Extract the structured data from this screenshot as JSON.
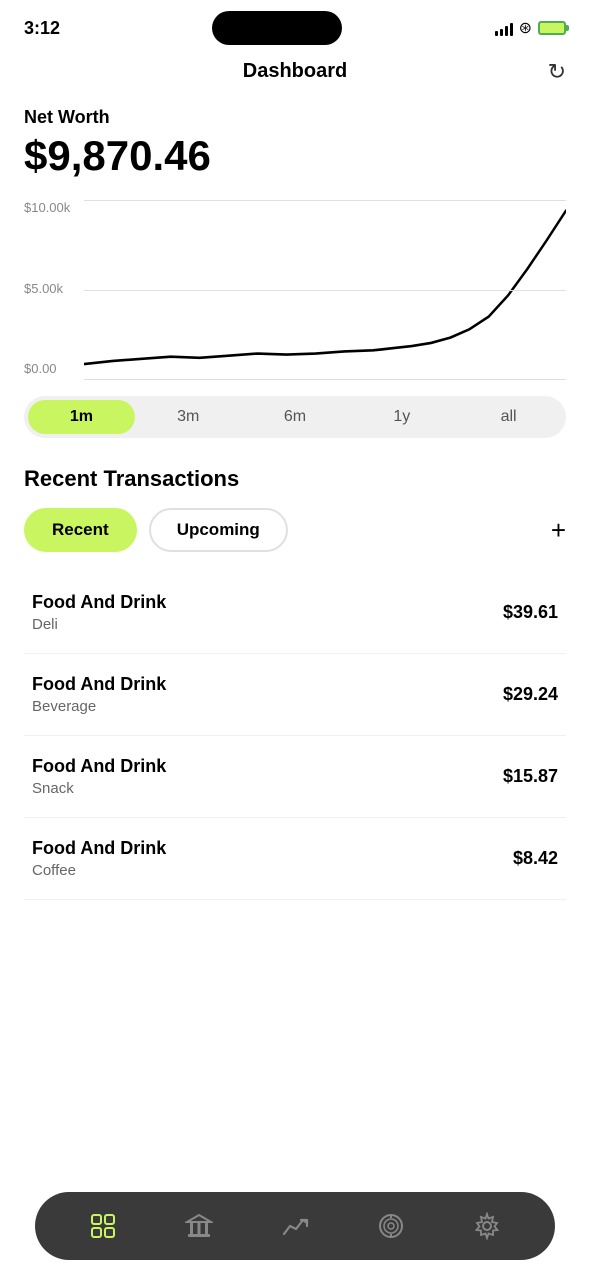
{
  "statusBar": {
    "time": "3:12",
    "signalBars": [
      4,
      7,
      10,
      13,
      15
    ],
    "batteryColor": "#c8f560"
  },
  "header": {
    "title": "Dashboard",
    "refreshLabel": "↻"
  },
  "netWorth": {
    "label": "Net Worth",
    "value": "$9,870.46"
  },
  "chart": {
    "yLabels": [
      "$10.00k",
      "$5.00k",
      "$0.00"
    ],
    "accentColor": "#c8f560"
  },
  "timeRange": {
    "options": [
      "1m",
      "3m",
      "6m",
      "1y",
      "all"
    ],
    "active": "1m"
  },
  "recentTransactions": {
    "sectionTitle": "Recent Transactions",
    "tabs": [
      {
        "label": "Recent",
        "active": true
      },
      {
        "label": "Upcoming",
        "active": false
      }
    ],
    "addLabel": "+",
    "items": [
      {
        "category": "Food And Drink",
        "sub": "Deli",
        "amount": "$39.61"
      },
      {
        "category": "Food And Drink",
        "sub": "Beverage",
        "amount": "$29.24"
      },
      {
        "category": "Food And Drink",
        "sub": "Snack",
        "amount": "$15.87"
      },
      {
        "category": "Food And Drink",
        "sub": "Coffee",
        "amount": "$8.42"
      }
    ]
  },
  "bottomNav": {
    "items": [
      {
        "name": "dashboard",
        "icon": "⊞",
        "active": true
      },
      {
        "name": "bank",
        "icon": "🏛",
        "active": false
      },
      {
        "name": "trends",
        "icon": "📈",
        "active": false
      },
      {
        "name": "goals",
        "icon": "🎯",
        "active": false
      },
      {
        "name": "settings",
        "icon": "⚙",
        "active": false
      }
    ]
  }
}
